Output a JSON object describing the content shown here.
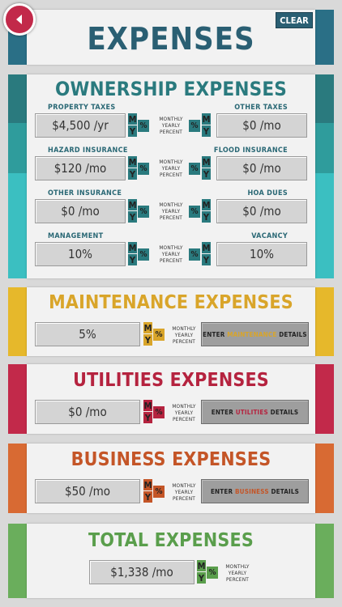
{
  "header": {
    "title": "EXPENSES",
    "clear_label": "CLEAR"
  },
  "colors": {
    "teal_dark": "#2a7a7e",
    "teal": "#2f9c9c",
    "teal_light": "#3bbfc1",
    "yellow": "#e6b82b",
    "red": "#c2294a",
    "orange": "#d86a33",
    "green": "#6aae5c"
  },
  "toggle_captions": {
    "monthly": "MONTHLY",
    "yearly": "YEARLY",
    "percent": "PERCENT"
  },
  "ownership": {
    "title": "OWNERSHIP EXPENSES",
    "rows": [
      {
        "left_label": "PROPERTY TAXES",
        "left_value": "$4,500 /yr",
        "right_label": "OTHER TAXES",
        "right_value": "$0 /mo"
      },
      {
        "left_label": "HAZARD INSURANCE",
        "left_value": "$120 /mo",
        "right_label": "FLOOD INSURANCE",
        "right_value": "$0 /mo"
      },
      {
        "left_label": "OTHER INSURANCE",
        "left_value": "$0 /mo",
        "right_label": "HOA DUES",
        "right_value": "$0 /mo"
      },
      {
        "left_label": "MANAGEMENT",
        "left_value": "10%",
        "right_label": "VACANCY",
        "right_value": "10%"
      }
    ]
  },
  "maintenance": {
    "title": "MAINTENANCE EXPENSES",
    "value": "5%",
    "btn_pre": "ENTER",
    "btn_key": "MAINTENANCE",
    "btn_post": "DETAILS"
  },
  "utilities": {
    "title": "UTILITIES EXPENSES",
    "value": "$0 /mo",
    "btn_pre": "ENTER",
    "btn_key": "UTILITIES",
    "btn_post": "DETAILS"
  },
  "business": {
    "title": "BUSINESS EXPENSES",
    "value": "$50 /mo",
    "btn_pre": "ENTER",
    "btn_key": "BUSINESS",
    "btn_post": "DETAILS"
  },
  "total": {
    "title": "TOTAL EXPENSES",
    "value": "$1,338 /mo"
  }
}
